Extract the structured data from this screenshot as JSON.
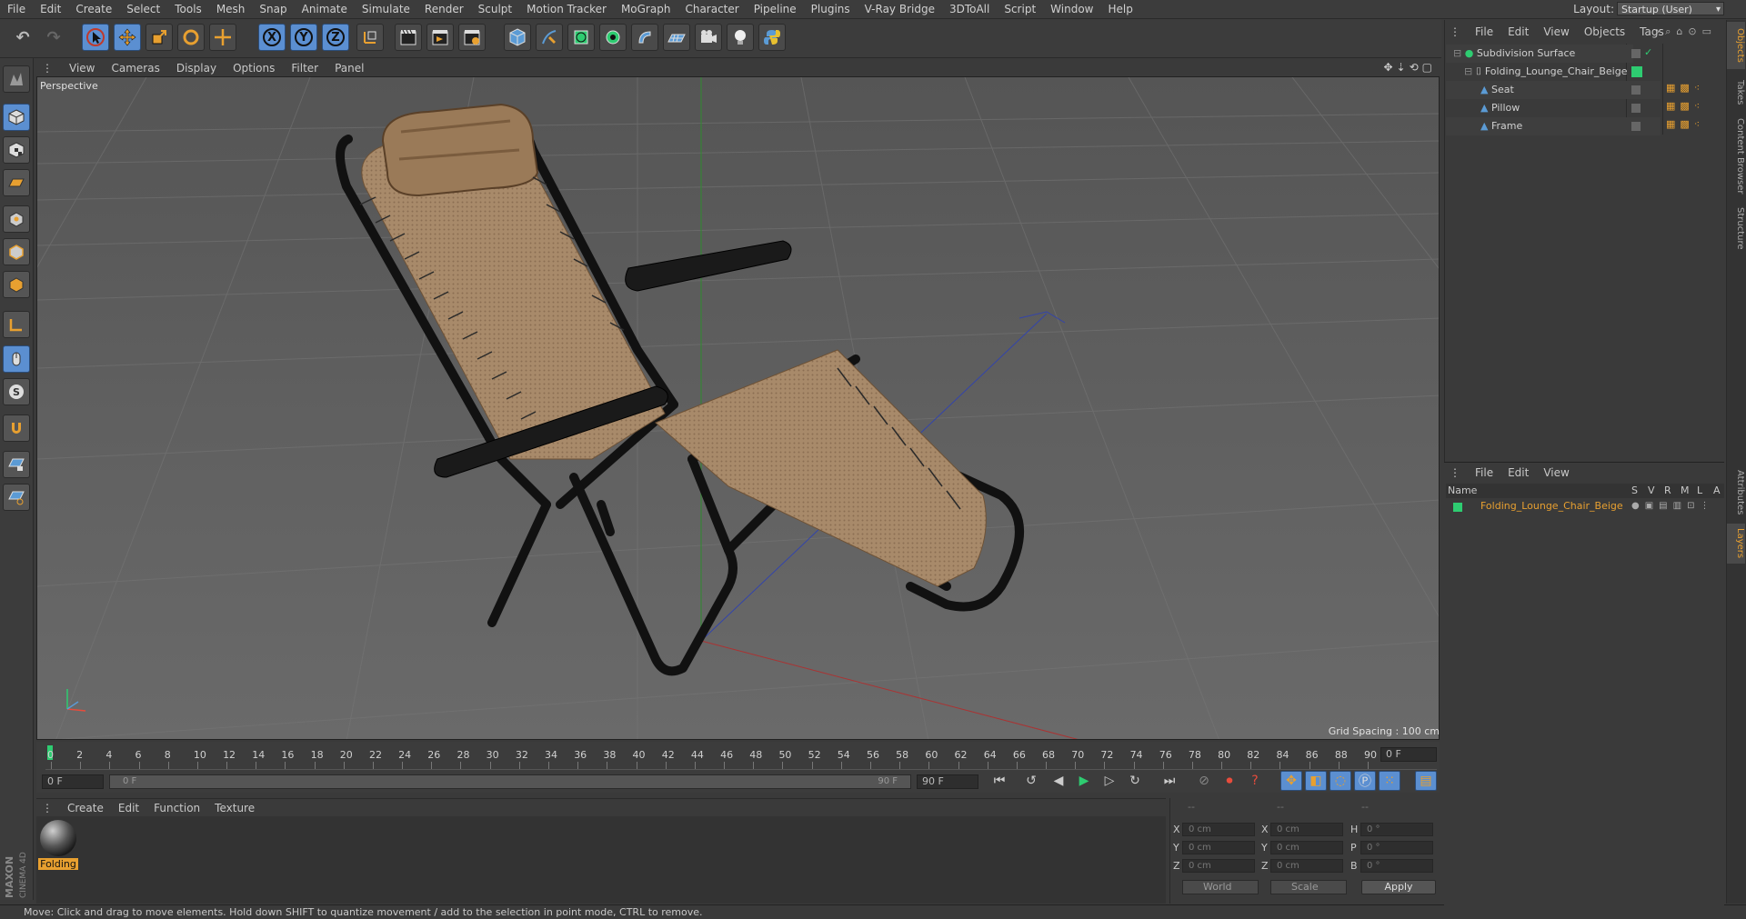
{
  "menubar": {
    "items": [
      "File",
      "Edit",
      "Create",
      "Select",
      "Tools",
      "Mesh",
      "Snap",
      "Animate",
      "Simulate",
      "Render",
      "Sculpt",
      "Motion Tracker",
      "MoGraph",
      "Character",
      "Pipeline",
      "Plugins",
      "V-Ray Bridge",
      "3DToAll",
      "Script",
      "Window",
      "Help"
    ],
    "layout_label": "Layout:",
    "layout_value": "Startup (User)"
  },
  "toolbar": {
    "axis_x": "X",
    "axis_y": "Y",
    "axis_z": "Z"
  },
  "viewport": {
    "menu": [
      "View",
      "Cameras",
      "Display",
      "Options",
      "Filter",
      "Panel"
    ],
    "label": "Perspective",
    "grid_spacing": "Grid Spacing : 100 cm"
  },
  "timeline": {
    "ticks": [
      "0",
      "2",
      "4",
      "6",
      "8",
      "10",
      "12",
      "14",
      "16",
      "18",
      "20",
      "22",
      "24",
      "26",
      "28",
      "30",
      "32",
      "34",
      "36",
      "38",
      "40",
      "42",
      "44",
      "46",
      "48",
      "50",
      "52",
      "54",
      "56",
      "58",
      "60",
      "62",
      "64",
      "66",
      "68",
      "70",
      "72",
      "74",
      "76",
      "78",
      "80",
      "82",
      "84",
      "86",
      "88",
      "90"
    ],
    "current_frame": "0 F",
    "start_field": "0 F",
    "range_start": "0 F",
    "range_end": "90 F",
    "end_field": "90 F"
  },
  "material_manager": {
    "menu": [
      "Create",
      "Edit",
      "Function",
      "Texture"
    ],
    "material_label": "Folding"
  },
  "coordinates": {
    "header_a": "--",
    "header_b": "--",
    "header_c": "--",
    "x_label": "X",
    "y_label": "Y",
    "z_label": "Z",
    "x2_label": "X",
    "y2_label": "Y",
    "z2_label": "Z",
    "h_label": "H",
    "p_label": "P",
    "b_label": "B",
    "pos_x": "0 cm",
    "pos_y": "0 cm",
    "pos_z": "0 cm",
    "size_x": "0 cm",
    "size_y": "0 cm",
    "size_z": "0 cm",
    "rot_h": "0 °",
    "rot_p": "0 °",
    "rot_b": "0 °",
    "world_select": "World",
    "scale_select": "Scale",
    "apply": "Apply"
  },
  "object_manager": {
    "menu": [
      "File",
      "Edit",
      "View",
      "Objects",
      "Tags"
    ],
    "objects": [
      {
        "name": "Subdivision Surface",
        "indent": 0
      },
      {
        "name": "Folding_Lounge_Chair_Beige",
        "indent": 1
      },
      {
        "name": "Seat",
        "indent": 2
      },
      {
        "name": "Pillow",
        "indent": 2
      },
      {
        "name": "Frame",
        "indent": 2
      }
    ]
  },
  "layer_manager": {
    "menu": [
      "File",
      "Edit",
      "View"
    ],
    "col_name": "Name",
    "cols": [
      "S",
      "V",
      "R",
      "M",
      "L",
      "A"
    ],
    "layer_name": "Folding_Lounge_Chair_Beige"
  },
  "side_tabs": [
    "Objects",
    "Takes",
    "Content Browser",
    "Structure",
    "Attributes",
    "Layers"
  ],
  "status": "Move: Click and drag to move elements. Hold down SHIFT to quantize movement / add to the selection in point mode, CTRL to remove.",
  "colors": {
    "accent_orange": "#e8a030",
    "button_blue": "#5b8fd1",
    "layer_green": "#2ecc71"
  }
}
